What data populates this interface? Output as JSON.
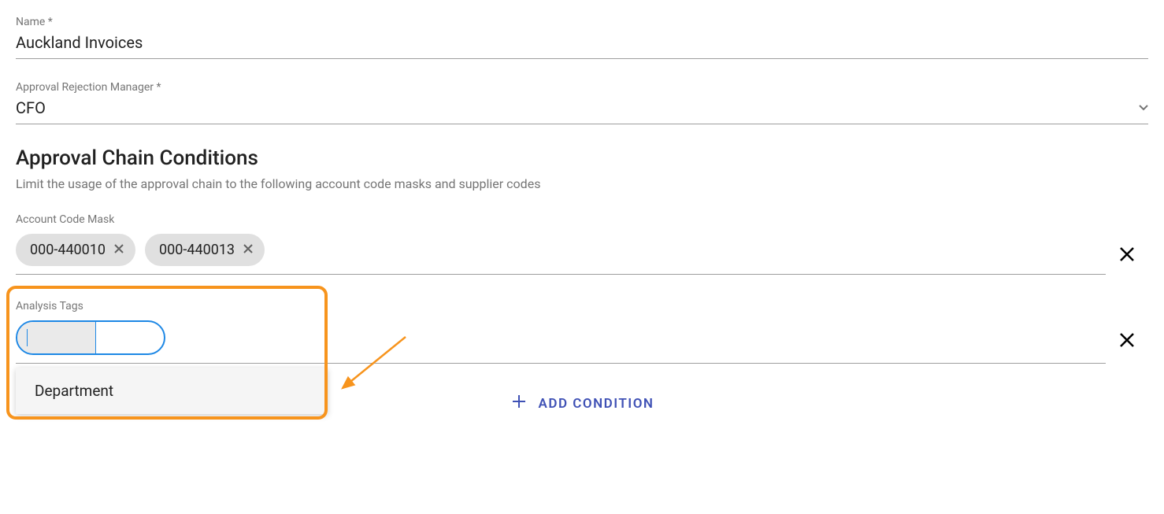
{
  "fields": {
    "name": {
      "label": "Name *",
      "value": "Auckland Invoices"
    },
    "rejectionManager": {
      "label": "Approval Rejection Manager *",
      "value": "CFO"
    }
  },
  "section": {
    "title": "Approval Chain Conditions",
    "description": "Limit the usage of the approval chain to the following account code masks and supplier codes"
  },
  "conditions": {
    "accountMask": {
      "label": "Account Code Mask",
      "chips": [
        "000-440010",
        "000-440013"
      ]
    },
    "analysisTags": {
      "label": "Analysis Tags",
      "options": [
        "Department"
      ]
    }
  },
  "actions": {
    "addCondition": "ADD CONDITION"
  }
}
